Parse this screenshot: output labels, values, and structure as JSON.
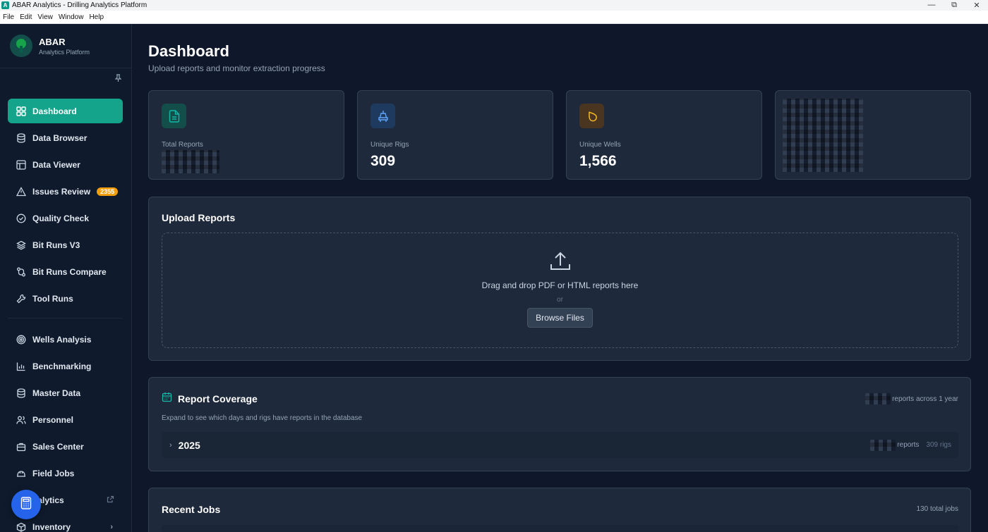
{
  "window": {
    "title": "ABAR Analytics - Drilling Analytics Platform",
    "app_icon": "A",
    "minimize": "—",
    "maximize": "⧉",
    "close": "✕"
  },
  "menu": [
    "File",
    "Edit",
    "View",
    "Window",
    "Help"
  ],
  "sidebar": {
    "brand_name": "ABAR",
    "brand_sub": "Analytics Platform",
    "pin_icon": "pin-icon",
    "items": [
      {
        "label": "Dashboard",
        "icon": "grid-icon",
        "active": true
      },
      {
        "label": "Data Browser",
        "icon": "database-icon"
      },
      {
        "label": "Data Viewer",
        "icon": "table-icon"
      },
      {
        "label": "Issues Review",
        "icon": "warning-icon",
        "badge": "2355"
      },
      {
        "label": "Quality Check",
        "icon": "check-circle-icon"
      },
      {
        "label": "Bit Runs V3",
        "icon": "layers-icon"
      },
      {
        "label": "Bit Runs Compare",
        "icon": "compare-icon"
      },
      {
        "label": "Tool Runs",
        "icon": "wrench-icon"
      },
      {
        "label": "Wells Analysis",
        "icon": "target-icon"
      },
      {
        "label": "Benchmarking",
        "icon": "bar-chart-icon"
      },
      {
        "label": "Master Data",
        "icon": "database-icon"
      },
      {
        "label": "Personnel",
        "icon": "users-icon"
      },
      {
        "label": "Sales Center",
        "icon": "briefcase-icon"
      },
      {
        "label": "Field Jobs",
        "icon": "hard-hat-icon"
      },
      {
        "label": "nalytics",
        "icon": "external-link-icon"
      },
      {
        "label": "Inventory",
        "icon": "box-icon"
      }
    ]
  },
  "header": {
    "title": "Dashboard",
    "subtitle": "Upload reports and monitor extraction progress"
  },
  "stats": [
    {
      "label": "Total Reports",
      "value": "",
      "icon": "document-icon",
      "color": "#14b8a6",
      "bg": "#134e4a"
    },
    {
      "label": "Unique Rigs",
      "value": "309",
      "icon": "rig-icon",
      "color": "#60a5fa",
      "bg": "#1e3a5f"
    },
    {
      "label": "Unique Wells",
      "value": "1,566",
      "icon": "droplet-icon",
      "color": "#fbbf24",
      "bg": "#4a3520"
    }
  ],
  "upload": {
    "title": "Upload Reports",
    "drop_text": "Drag and drop PDF or HTML reports here",
    "or": "or",
    "browse": "Browse Files"
  },
  "coverage": {
    "title": "Report Coverage",
    "summary": "reports across 1 year",
    "description": "Expand to see which days and rigs have reports in the database",
    "year": "2025",
    "year_reports": "reports",
    "year_rigs": "309 rigs"
  },
  "jobs": {
    "title": "Recent Jobs",
    "total": "130 total jobs"
  }
}
